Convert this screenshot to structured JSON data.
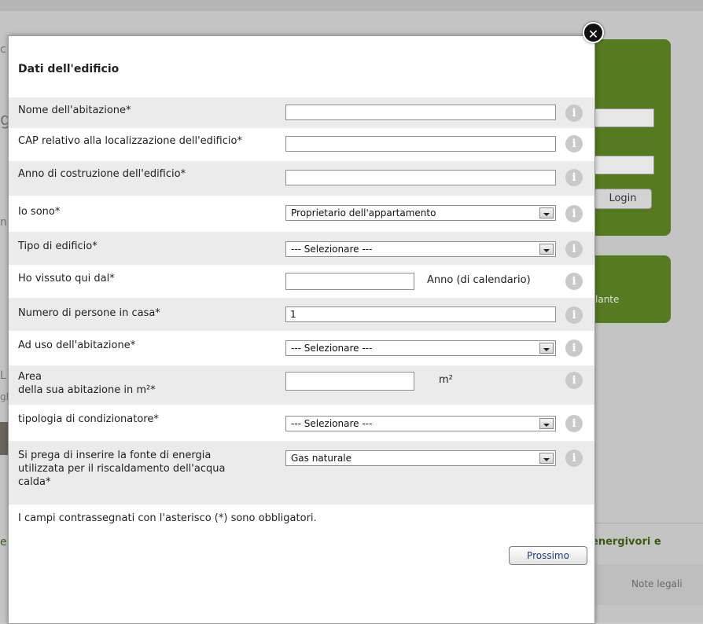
{
  "background": {
    "login_label": "Login",
    "green_panel_text": "lante",
    "section_heading": "energivori e",
    "footer_link": "Note legali",
    "left_fragments": [
      "c",
      "g",
      "n",
      "L",
      "e",
      "gl"
    ]
  },
  "modal": {
    "title": "Dati dell'edificio",
    "close_symbol": "✕",
    "info_symbol": "i",
    "fields": {
      "home_name": {
        "label": "Nome dell'abitazione*",
        "value": ""
      },
      "cap": {
        "label": "CAP relativo alla localizzazione dell'edificio*",
        "value": ""
      },
      "year_built": {
        "label": "Anno di costruzione dell'edificio*",
        "value": ""
      },
      "i_am": {
        "label": "Io sono*",
        "selected": "Proprietario dell'appartamento"
      },
      "building_type": {
        "label": "Tipo di edificio*",
        "selected": "--- Selezionare ---"
      },
      "lived_since": {
        "label": "Ho vissuto qui dal*",
        "value": "",
        "suffix": "Anno (di calendario)"
      },
      "persons": {
        "label": "Numero di persone in casa*",
        "value": "1"
      },
      "usage": {
        "label": "Ad uso dell'abitazione*",
        "selected": "--- Selezionare ---"
      },
      "area": {
        "label_line1": "Area",
        "label_line2": "della sua abitazione in m²*",
        "value": "",
        "unit": "m²"
      },
      "ac_type": {
        "label": "tipologia di condizionatore*",
        "selected": "--- Selezionare ---"
      },
      "energy_source": {
        "label_line1": "Si prega di inserire la fonte di energia",
        "label_line2": "utilizzata per il riscaldamento dell'acqua",
        "label_line3": "calda*",
        "selected": "Gas naturale"
      }
    },
    "required_note": "I campi contrassegnati con l'asterisco (*) sono obbligatori.",
    "next_label": "Prossimo"
  },
  "colors": {
    "accent_green": "#557a20",
    "row_shade": "#ebebeb",
    "button_text": "#1f3f7a"
  }
}
